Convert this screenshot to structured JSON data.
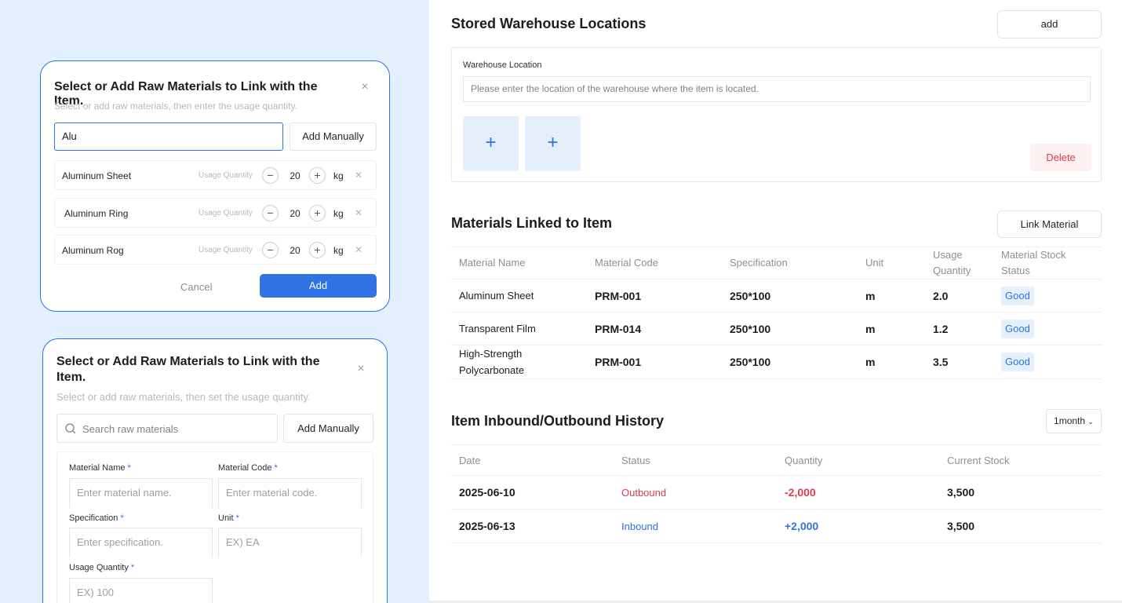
{
  "dialog_select": {
    "title": "Select or Add Raw Materials to Link with the Item.",
    "subtitle": "Select or add raw materials, then enter the usage quantity.",
    "close": "×",
    "search_value": "Alu",
    "add_manually": "Add Manually",
    "usage_label": "Usage Quantity",
    "items": [
      {
        "name": "Aluminum Sheet",
        "qty": "20",
        "unit": "kg"
      },
      {
        "name": "Aluminum Ring",
        "qty": "20",
        "unit": "kg"
      },
      {
        "name": "Aluminum Rog",
        "qty": "20",
        "unit": "kg"
      }
    ],
    "cancel": "Cancel",
    "add": "Add"
  },
  "dialog_add": {
    "title": "Select or Add Raw Materials to Link with the Item.",
    "subtitle": "Select or add raw materials, then set the usage quantity.",
    "close": "×",
    "search_placeholder": "Search raw materials",
    "add_manually": "Add Manually",
    "fields": {
      "material_name": {
        "label": "Material Name",
        "placeholder": "Enter material name."
      },
      "material_code": {
        "label": "Material Code",
        "placeholder": "Enter material code."
      },
      "specification": {
        "label": "Specification",
        "placeholder": "Enter specification."
      },
      "unit": {
        "label": "Unit",
        "placeholder": "EX) EA"
      },
      "usage_quantity": {
        "label": "Usage Quantity",
        "placeholder": "EX) 100"
      }
    },
    "required_mark": "*"
  },
  "warehouse": {
    "title": "Stored Warehouse Locations",
    "add_button": "add",
    "field_label": "Warehouse Location",
    "field_placeholder": "Please enter the location of the warehouse where the item is located.",
    "plus": "+",
    "delete_button": "Delete"
  },
  "materials": {
    "title": "Materials Linked to Item",
    "link_button": "Link Material",
    "headers": [
      "Material Name",
      "Material Code",
      "Specification",
      "Unit",
      "Usage Quantity",
      "Material Stock Status"
    ],
    "rows": [
      {
        "name": "Aluminum Sheet",
        "code": "PRM-001",
        "spec": "250*100",
        "unit": "m",
        "qty": "2.0",
        "status": "Good"
      },
      {
        "name": "Transparent Film",
        "code": "PRM-014",
        "spec": "250*100",
        "unit": "m",
        "qty": "1.2",
        "status": "Good"
      },
      {
        "name": "High-Strength Polycarbonate",
        "code": "PRM-001",
        "spec": "250*100",
        "unit": "m",
        "qty": "3.5",
        "status": "Good"
      }
    ]
  },
  "history": {
    "title": "Item Inbound/Outbound History",
    "period": "1month",
    "headers": [
      "Date",
      "Status",
      "Quantity",
      "Current Stock"
    ],
    "rows": [
      {
        "date": "2025-06-10",
        "status": "Outbound",
        "qty": "-2,000",
        "stock": "3,500"
      },
      {
        "date": "2025-06-13",
        "status": "Inbound",
        "qty": "+2,000",
        "stock": "3,500"
      }
    ]
  },
  "colors": {
    "accent": "#2f72e4",
    "danger": "#e5384f",
    "left_bg": "#e3f0fd"
  }
}
